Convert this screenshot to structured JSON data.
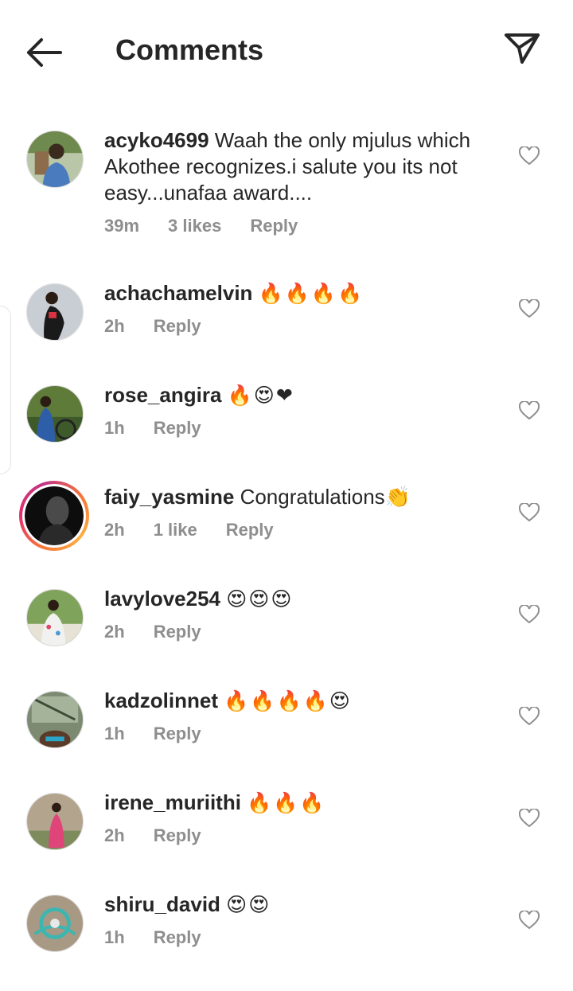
{
  "header": {
    "title": "Comments",
    "back_icon": "arrow-left-icon",
    "send_icon": "paper-plane-icon"
  },
  "colors": {
    "text": "#262626",
    "meta": "#8e8e8e",
    "story_ring_start": "#f77737",
    "story_ring_end": "#e1306c"
  },
  "comments": [
    {
      "username": "acyko4699",
      "text": "Waah the only mjulus which Akothee recognizes.i salute you its not easy...unafaa award....",
      "time": "39m",
      "likes": "3 likes",
      "reply": "Reply"
    },
    {
      "username": "achachamelvin",
      "text": "🔥🔥🔥🔥",
      "time": "2h",
      "likes": "",
      "reply": "Reply"
    },
    {
      "username": "rose_angira",
      "text": "🔥😍❤",
      "time": "1h",
      "likes": "",
      "reply": "Reply"
    },
    {
      "username": "faiy_yasmine",
      "text": "Congratulations👏",
      "time": "2h",
      "likes": "1 like",
      "reply": "Reply",
      "has_story": true
    },
    {
      "username": "lavylove254",
      "text": "😍😍😍",
      "time": "2h",
      "likes": "",
      "reply": "Reply"
    },
    {
      "username": "kadzolinnet",
      "text": "🔥🔥🔥🔥😍",
      "time": "1h",
      "likes": "",
      "reply": "Reply"
    },
    {
      "username": "irene_muriithi",
      "text": "🔥🔥🔥",
      "time": "2h",
      "likes": "",
      "reply": "Reply"
    },
    {
      "username": "shiru_david",
      "text": "😍😍",
      "time": "1h",
      "likes": "",
      "reply": "Reply"
    }
  ]
}
